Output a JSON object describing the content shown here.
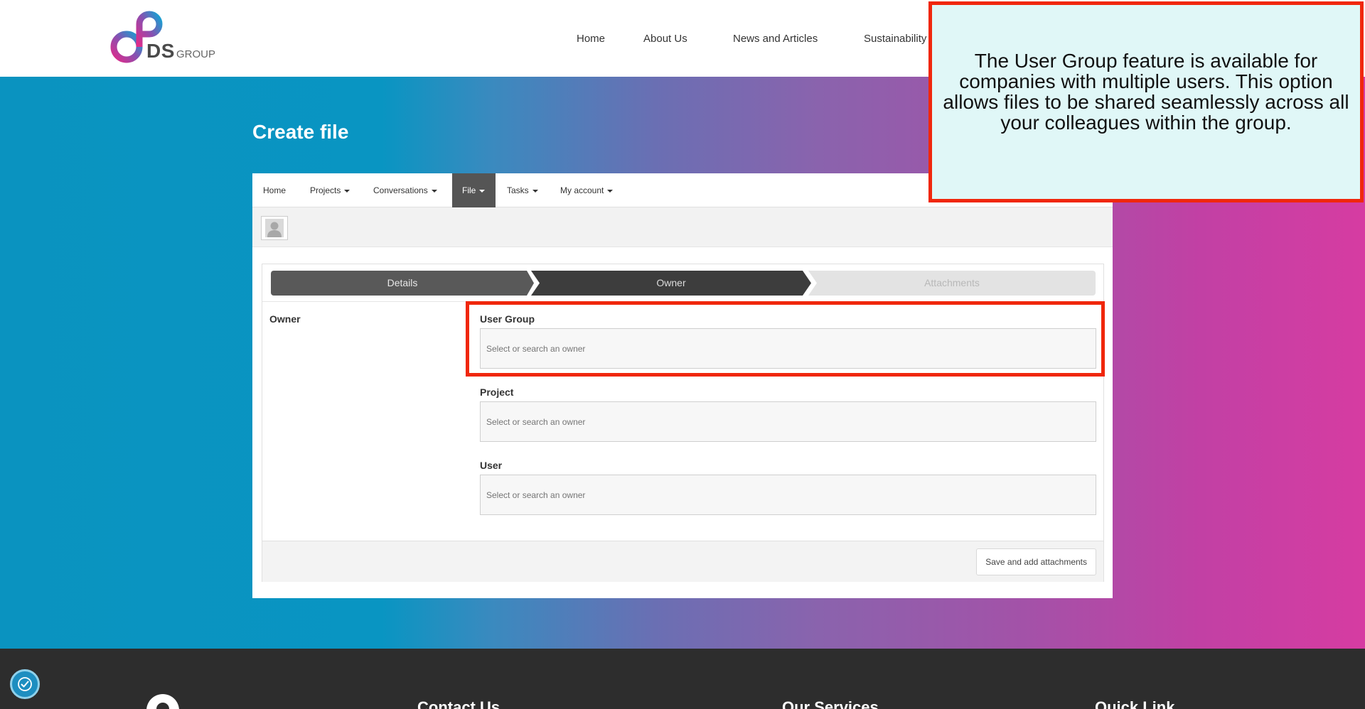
{
  "header": {
    "logo": {
      "brand_text": "DS",
      "group_text": "GROUP",
      "icon": "ds-logo-icon"
    },
    "nav": [
      {
        "label": "Home"
      },
      {
        "label": "About Us"
      },
      {
        "label": "News and Articles"
      },
      {
        "label": "Sustainability"
      }
    ]
  },
  "page": {
    "title": "Create file"
  },
  "app_tabs": [
    {
      "label": "Home",
      "dropdown": false
    },
    {
      "label": "Projects",
      "dropdown": true
    },
    {
      "label": "Conversations",
      "dropdown": true
    },
    {
      "label": "File",
      "dropdown": true,
      "active": true
    },
    {
      "label": "Tasks",
      "dropdown": true
    },
    {
      "label": "My account",
      "dropdown": true
    }
  ],
  "wizard": {
    "steps": [
      {
        "label": "Details",
        "state": "completed"
      },
      {
        "label": "Owner",
        "state": "current"
      },
      {
        "label": "Attachments",
        "state": "upcoming"
      }
    ]
  },
  "form": {
    "section_label": "Owner",
    "fields": [
      {
        "label": "User Group",
        "placeholder": "Select or search an owner"
      },
      {
        "label": "Project",
        "placeholder": "Select or search an owner"
      },
      {
        "label": "User",
        "placeholder": "Select or search an owner"
      }
    ],
    "save_button": "Save and add attachments"
  },
  "callout": {
    "text": "The User Group feature is available for companies with multiple users. This option allows files to be shared seamlessly across all your colleagues within the group."
  },
  "footer": {
    "headings": [
      "Contact Us",
      "Our Services",
      "Quick Link"
    ]
  },
  "colors": {
    "highlight": "#f0270c",
    "callout_bg": "#e0f7f7",
    "gradient_start": "#0a93c0",
    "gradient_end": "#d63ca2",
    "footer_bg": "#2d2d2d"
  }
}
